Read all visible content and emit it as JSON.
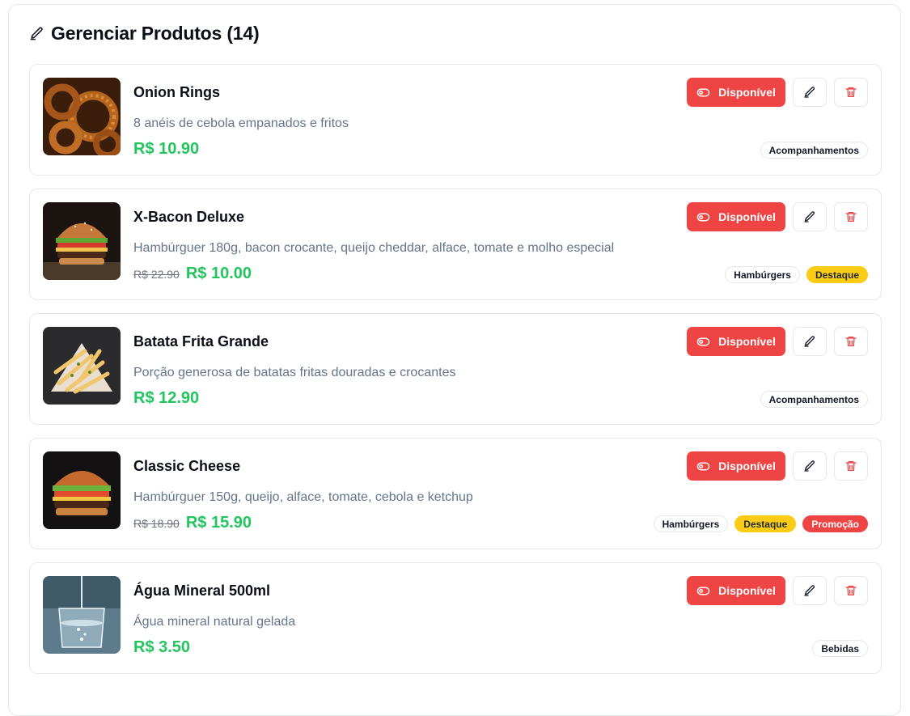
{
  "page": {
    "title": "Gerenciar Produtos (14)",
    "icon": "pencil-icon"
  },
  "labels": {
    "available": "Disponível"
  },
  "colors": {
    "accent_red": "#ef4444",
    "price_green": "#22c55e",
    "featured_yellow": "#facc15"
  },
  "products": [
    {
      "name": "Onion Rings",
      "description": "8 anéis de cebola empanados e fritos",
      "old_price": "",
      "price": "R$ 10.90",
      "tags": [
        {
          "label": "Acompanhamentos",
          "kind": "category"
        }
      ],
      "image": "onion-rings-image"
    },
    {
      "name": "X-Bacon Deluxe",
      "description": "Hambúrguer 180g, bacon crocante, queijo cheddar, alface, tomate e molho especial",
      "old_price": "R$ 22.90",
      "price": "R$ 10.00",
      "tags": [
        {
          "label": "Hambúrgers",
          "kind": "category"
        },
        {
          "label": "Destaque",
          "kind": "featured"
        }
      ],
      "image": "burger-image"
    },
    {
      "name": "Batata Frita Grande",
      "description": "Porção generosa de batatas fritas douradas e crocantes",
      "old_price": "",
      "price": "R$ 12.90",
      "tags": [
        {
          "label": "Acompanhamentos",
          "kind": "category"
        }
      ],
      "image": "fries-image"
    },
    {
      "name": "Classic Cheese",
      "description": "Hambúrguer 150g, queijo, alface, tomate, cebola e ketchup",
      "old_price": "R$ 18.90",
      "price": "R$ 15.90",
      "tags": [
        {
          "label": "Hambúrgers",
          "kind": "category"
        },
        {
          "label": "Destaque",
          "kind": "featured"
        },
        {
          "label": "Promoção",
          "kind": "promo"
        }
      ],
      "image": "cheeseburger-image"
    },
    {
      "name": "Água Mineral 500ml",
      "description": "Água mineral natural gelada",
      "old_price": "",
      "price": "R$ 3.50",
      "tags": [
        {
          "label": "Bebidas",
          "kind": "category"
        }
      ],
      "image": "water-glass-image"
    }
  ]
}
